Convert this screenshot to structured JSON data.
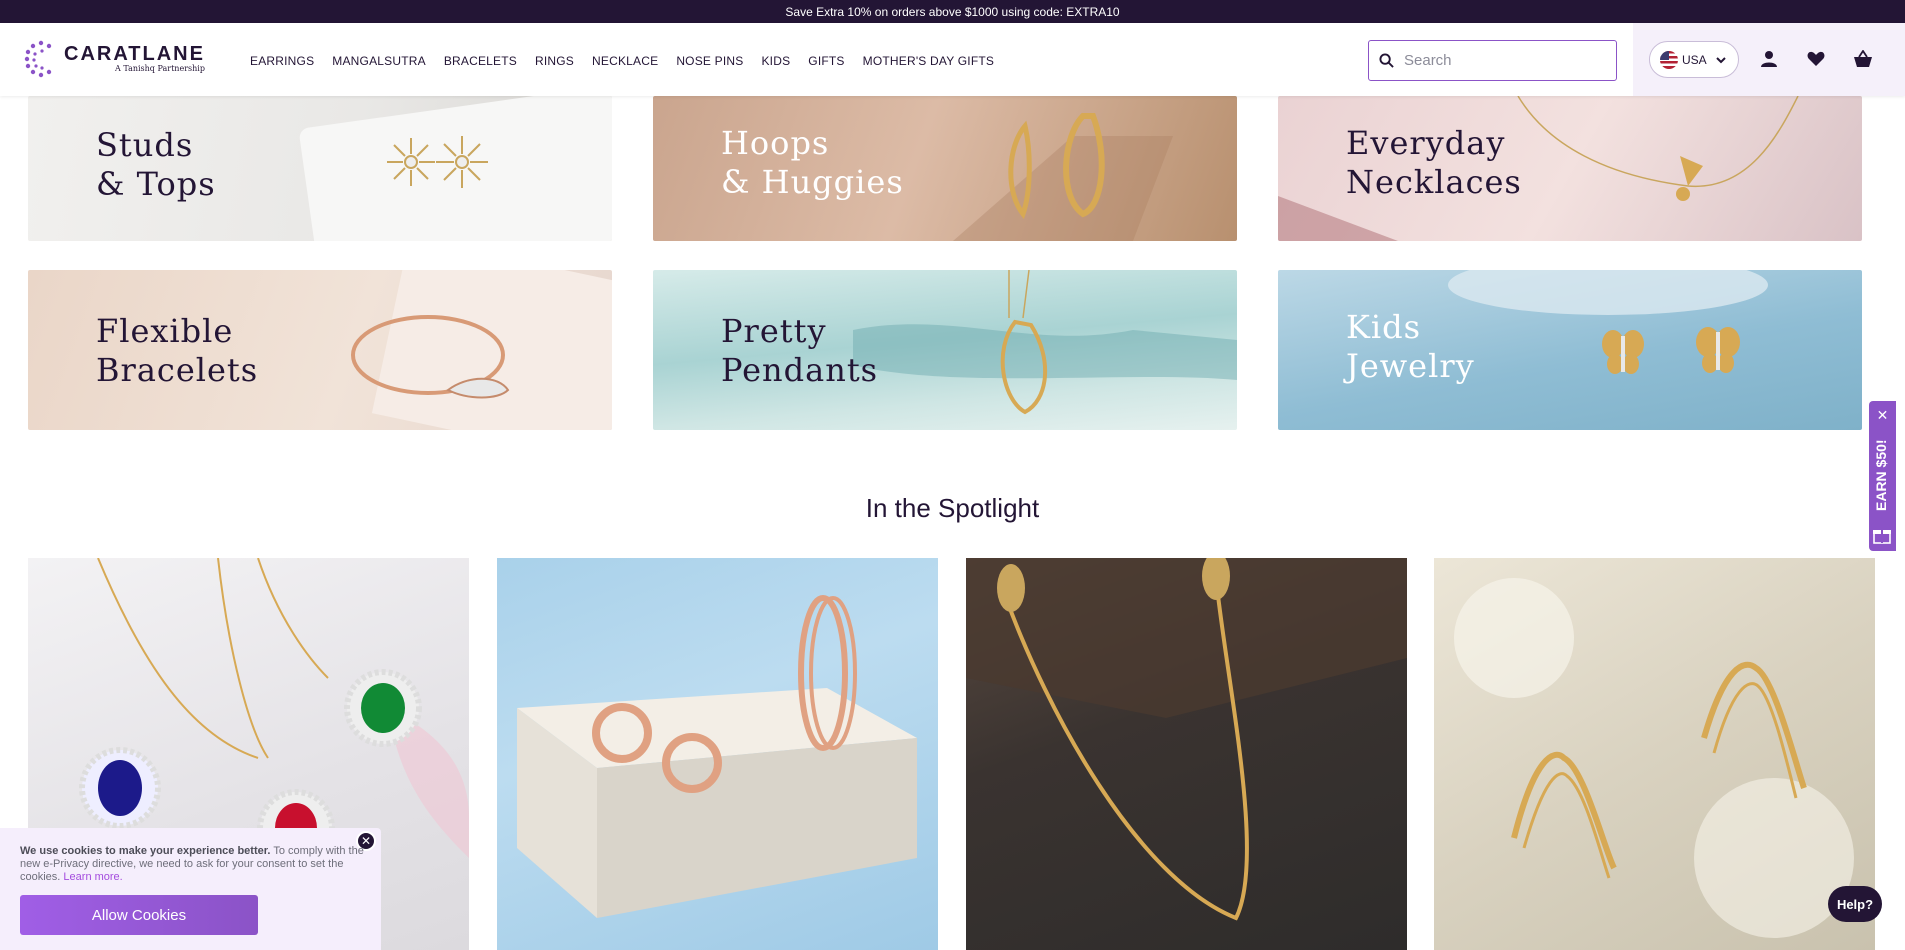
{
  "promo": {
    "text": "Save Extra 10% on orders above $1000 using code: EXTRA10"
  },
  "header": {
    "logo_name": "CARATLANE",
    "logo_sub": "A Tanishq Partnership",
    "nav": [
      "EARRINGS",
      "MANGALSUTRA",
      "BRACELETS",
      "RINGS",
      "NECKLACE",
      "NOSE PINS",
      "KIDS",
      "GIFTS",
      "MOTHER'S DAY GIFTS"
    ],
    "search_placeholder": "Search",
    "country": "USA",
    "icons": [
      "user-icon",
      "heart-icon",
      "cart-icon"
    ]
  },
  "categories": [
    {
      "label": "Studs\n& Tops"
    },
    {
      "label": "Hoops\n& Huggies"
    },
    {
      "label": "Everyday\nNecklaces"
    },
    {
      "label": "Flexible\nBracelets"
    },
    {
      "label": "Pretty\nPendants"
    },
    {
      "label": "Kids\nJewelry"
    }
  ],
  "spotlight": {
    "title": "In the Spotlight"
  },
  "cookie": {
    "bold": "We use cookies to make your experience better.",
    "text": " To comply with the new e-Privacy directive, we need to ask for your consent to set the cookies. ",
    "link": "Learn more.",
    "button": "Allow Cookies"
  },
  "earn": {
    "label": "EARN $50!"
  },
  "help": {
    "label": "Help?"
  },
  "colors": {
    "brand": "#231535",
    "accent": "#8b53c7"
  }
}
